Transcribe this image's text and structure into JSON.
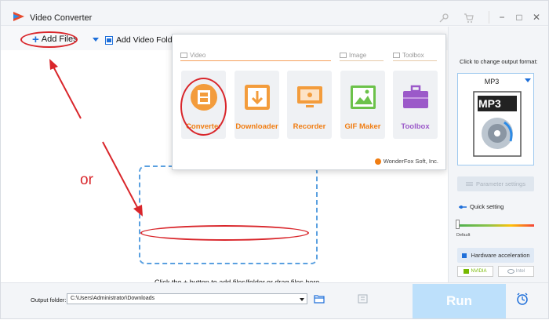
{
  "window": {
    "title": "Video Converter",
    "controls": [
      "−",
      "□",
      "✕"
    ]
  },
  "toolbar": {
    "add_files": "Add Files",
    "add_video_folder": "Add Video Folder"
  },
  "main": {
    "drop_hint": "Click the + button to add files/folder,or drag files here.",
    "or_label": "or"
  },
  "popup": {
    "sections": {
      "video": "Video",
      "image": "Image",
      "toolbox": "Toolbox"
    },
    "tiles": [
      {
        "label": "Converter",
        "icon": "film-icon"
      },
      {
        "label": "Downloader",
        "icon": "download-icon"
      },
      {
        "label": "Recorder",
        "icon": "screen-recorder-icon"
      },
      {
        "label": "GIF Maker",
        "icon": "image-icon"
      },
      {
        "label": "Toolbox",
        "icon": "toolbox-icon"
      }
    ],
    "brand": "WonderFox Soft, Inc."
  },
  "right_panel": {
    "hint": "Click to change output format:",
    "format": "MP3",
    "format_art_label": "MP3",
    "param_settings": "Parameter settings",
    "quick_setting": "Quick setting",
    "default_label": "Default",
    "hw_accel": "Hardware acceleration",
    "nvidia": "NVIDIA",
    "intel": "Intel"
  },
  "bottom": {
    "output_label": "Output folder:",
    "output_path": "C:\\Users\\Administrator\\Downloads",
    "run": "Run"
  },
  "colors": {
    "accent": "#1e6fd9",
    "tile_orange": "#f07d12",
    "annotation_red": "#d9262b",
    "run_bg": "#bde0fb"
  }
}
